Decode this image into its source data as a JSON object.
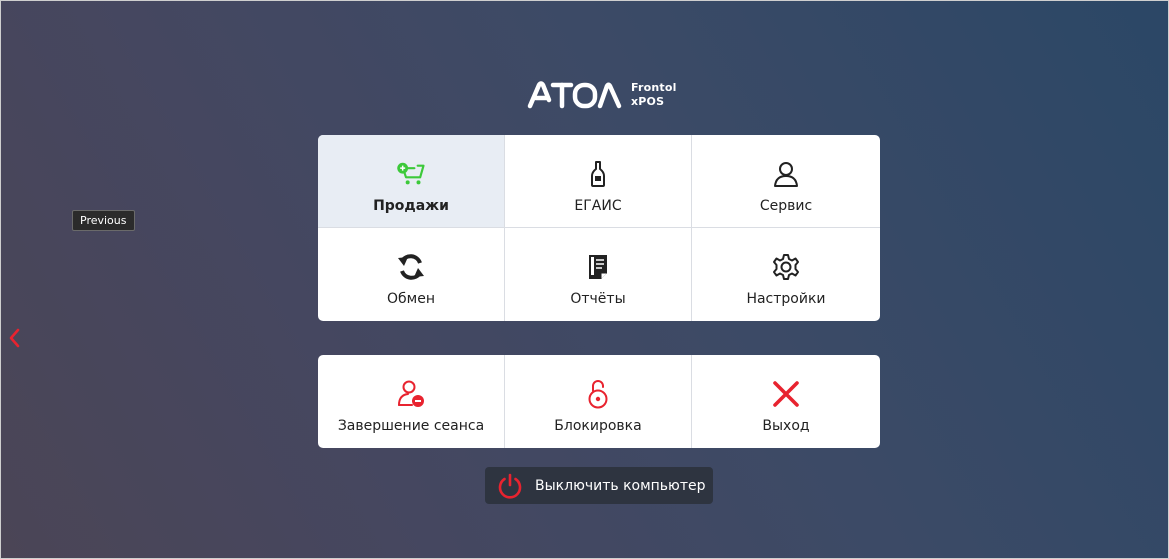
{
  "logo": {
    "brand": "АТОЛ",
    "product_line1": "Frontol",
    "product_line2": "xPOS"
  },
  "tooltip": {
    "previous": "Previous"
  },
  "main_menu": [
    {
      "label": "Продажи",
      "icon": "cart-add-icon",
      "selected": true
    },
    {
      "label": "ЕГАИС",
      "icon": "bottle-icon"
    },
    {
      "label": "Сервис",
      "icon": "user-icon"
    },
    {
      "label": "Обмен",
      "icon": "sync-icon"
    },
    {
      "label": "Отчёты",
      "icon": "report-icon"
    },
    {
      "label": "Настройки",
      "icon": "gear-icon"
    }
  ],
  "session_menu": [
    {
      "label": "Завершение сеанса",
      "icon": "user-logout-icon"
    },
    {
      "label": "Блокировка",
      "icon": "unlock-icon"
    },
    {
      "label": "Выход",
      "icon": "close-icon"
    }
  ],
  "power": {
    "label": "Выключить компьютер",
    "icon": "power-icon"
  },
  "colors": {
    "accent_green": "#3cc93a",
    "danger_red": "#e8232f",
    "selected_bg": "#e8edf4",
    "power_bg": "#2e3440"
  }
}
